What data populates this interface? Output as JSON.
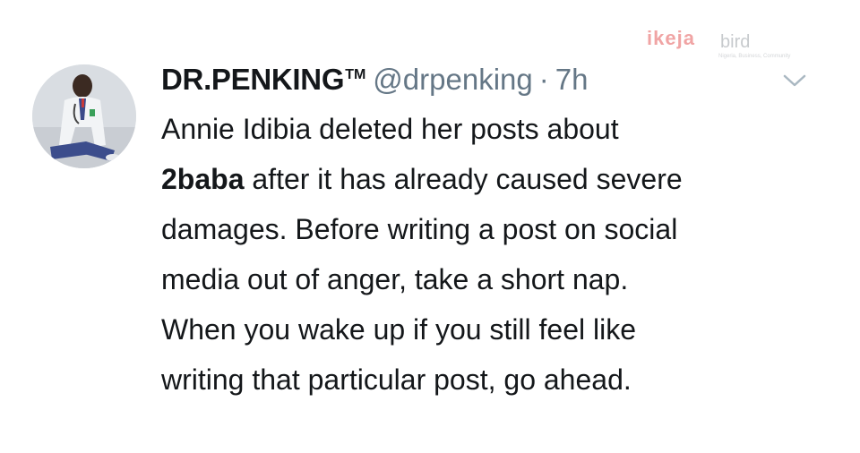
{
  "tweet": {
    "display_name": "DR.PENKING",
    "trademark": "TM",
    "handle": "@drpenking",
    "separator": "·",
    "time": "7h",
    "lines": [
      {
        "parts": [
          "Annie Idibia deleted her posts about"
        ]
      },
      {
        "bold": "2baba",
        "rest": " after it has already caused severe"
      },
      {
        "parts": [
          "damages. Before writing a post on social"
        ]
      },
      {
        "parts": [
          "media out of anger, take a short nap."
        ]
      },
      {
        "parts": [
          "When you wake up if you still feel like"
        ]
      },
      {
        "parts": [
          "writing that particular post, go ahead."
        ]
      }
    ]
  },
  "watermark": {
    "brand_a": "ikeja",
    "brand_b": "bird",
    "tagline": "Nigeria, Business, Community"
  },
  "icons": {
    "caret": "chevron-down-icon",
    "avatar": "avatar"
  },
  "colors": {
    "text": "#14171a",
    "secondary": "#657786",
    "watermark_accent": "#e55a5a"
  }
}
